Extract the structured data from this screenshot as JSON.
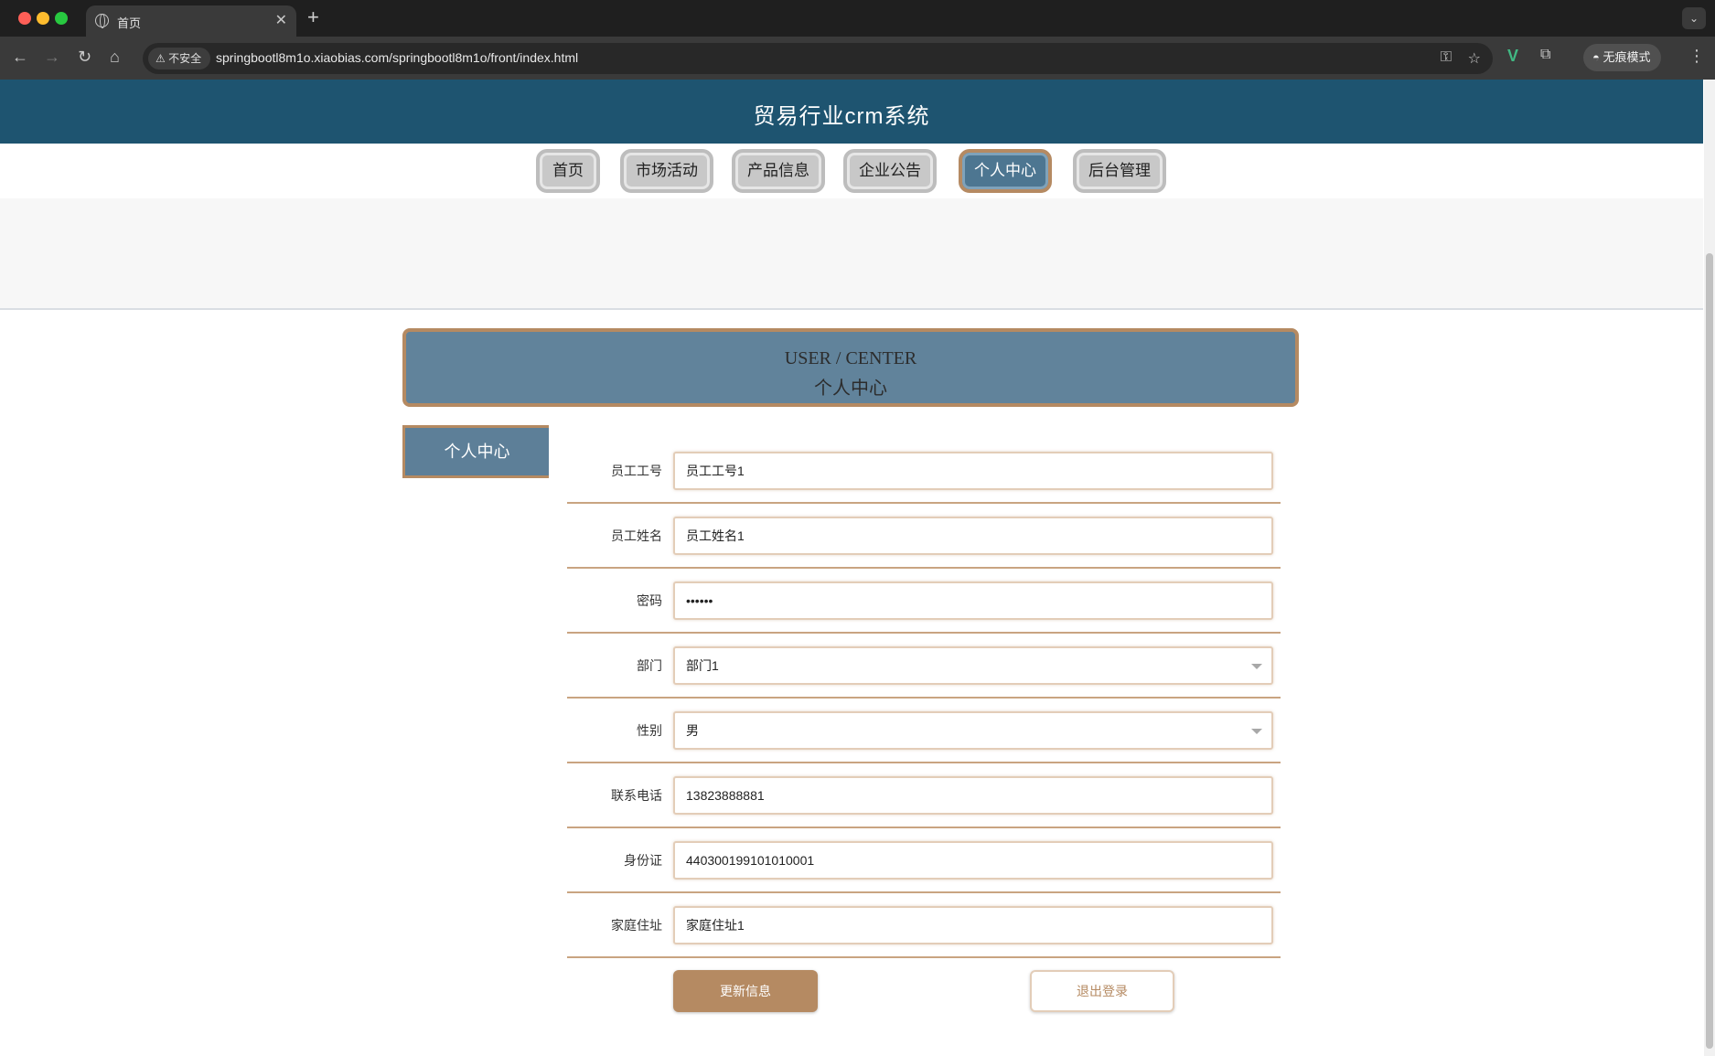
{
  "browser": {
    "tab_title": "首页",
    "tab_close": "✕",
    "new_tab": "+",
    "tab_menu": "⌄",
    "insecure_label": "不安全",
    "url": "springbootl8m1o.xiaobias.com/springbootl8m1o/front/index.html",
    "incognito_label": "无痕模式"
  },
  "site": {
    "title": "贸易行业crm系统"
  },
  "menu": {
    "items": [
      {
        "label": "首页",
        "active": false
      },
      {
        "label": "市场活动",
        "active": false
      },
      {
        "label": "产品信息",
        "active": false
      },
      {
        "label": "企业公告",
        "active": false
      },
      {
        "label": "个人中心",
        "active": true
      },
      {
        "label": "后台管理",
        "active": false
      }
    ]
  },
  "user_center": {
    "title_en": "USER / CENTER",
    "title_cn": "个人中心",
    "side_tab": "个人中心"
  },
  "form": {
    "fields": [
      {
        "label": "员工工号",
        "value": "员工工号1",
        "type": "text"
      },
      {
        "label": "员工姓名",
        "value": "员工姓名1",
        "type": "text"
      },
      {
        "label": "密码",
        "value": "••••••",
        "type": "password"
      },
      {
        "label": "部门",
        "value": "部门1",
        "type": "select"
      },
      {
        "label": "性别",
        "value": "男",
        "type": "select"
      },
      {
        "label": "联系电话",
        "value": "13823888881",
        "type": "text"
      },
      {
        "label": "身份证",
        "value": "440300199101010001",
        "type": "text"
      },
      {
        "label": "家庭住址",
        "value": "家庭住址1",
        "type": "text"
      }
    ],
    "update_button": "更新信息",
    "logout_button": "退出登录"
  },
  "colors": {
    "header": "#1e5470",
    "accent": "#b58a62",
    "active_menu": "#4d7691",
    "panel": "#61839b"
  },
  "icons": [
    "globe-icon",
    "back-icon",
    "forward-icon",
    "reload-icon",
    "home-icon",
    "warning-icon",
    "key-icon",
    "star-icon",
    "vue-devtools-icon",
    "extensions-icon",
    "incognito-icon",
    "kebab-menu-icon",
    "chevron-down-icon"
  ]
}
